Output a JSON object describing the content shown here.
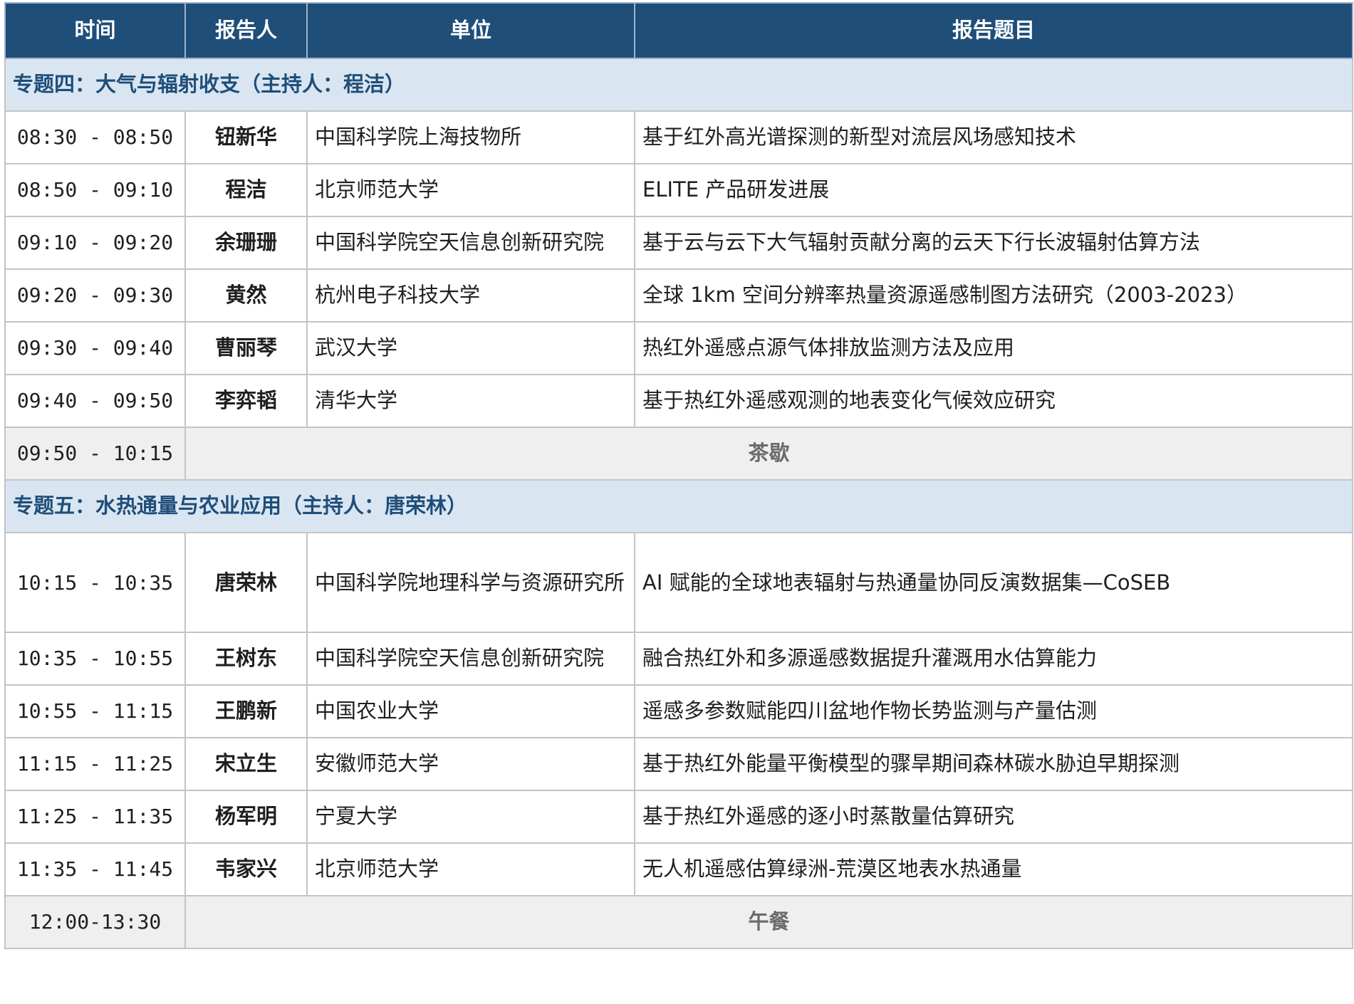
{
  "header": {
    "time": "时间",
    "speaker": "报告人",
    "org": "单位",
    "topic": "报告题目"
  },
  "sections": [
    {
      "title": "专题四：大气与辐射收支（主持人：程洁）",
      "rows": [
        {
          "time": "08:30 - 08:50",
          "speaker": "钮新华",
          "org": "中国科学院上海技物所",
          "topic": "基于红外高光谱探测的新型对流层风场感知技术"
        },
        {
          "time": "08:50 - 09:10",
          "speaker": "程洁",
          "org": "北京师范大学",
          "topic": "ELITE 产品研发进展"
        },
        {
          "time": "09:10 - 09:20",
          "speaker": "余珊珊",
          "org": "中国科学院空天信息创新研究院",
          "topic": "基于云与云下大气辐射贡献分离的云天下行长波辐射估算方法"
        },
        {
          "time": "09:20 - 09:30",
          "speaker": "黄然",
          "org": "杭州电子科技大学",
          "topic": "全球 1km 空间分辨率热量资源遥感制图方法研究（2003-2023）"
        },
        {
          "time": "09:30 - 09:40",
          "speaker": "曹丽琴",
          "org": "武汉大学",
          "topic": "热红外遥感点源气体排放监测方法及应用"
        },
        {
          "time": "09:40 - 09:50",
          "speaker": "李弈韬",
          "org": "清华大学",
          "topic": "基于热红外遥感观测的地表变化气候效应研究"
        }
      ],
      "break": {
        "time": "09:50 - 10:15",
        "label": "茶歇"
      }
    },
    {
      "title": "专题五：水热通量与农业应用（主持人：唐荣林）",
      "rows": [
        {
          "time": "10:15 - 10:35",
          "speaker": "唐荣林",
          "org": "中国科学院地理科学与资源研究所",
          "topic": "AI 赋能的全球地表辐射与热通量协同反演数据集—CoSEB"
        },
        {
          "time": "10:35 - 10:55",
          "speaker": "王树东",
          "org": "中国科学院空天信息创新研究院",
          "topic": "融合热红外和多源遥感数据提升灌溉用水估算能力"
        },
        {
          "time": "10:55 - 11:15",
          "speaker": "王鹏新",
          "org": "中国农业大学",
          "topic": "遥感多参数赋能四川盆地作物长势监测与产量估测"
        },
        {
          "time": "11:15 - 11:25",
          "speaker": "宋立生",
          "org": "安徽师范大学",
          "topic": "基于热红外能量平衡模型的骤旱期间森林碳水胁迫早期探测"
        },
        {
          "time": "11:25 - 11:35",
          "speaker": "杨军明",
          "org": "宁夏大学",
          "topic": "基于热红外遥感的逐小时蒸散量估算研究"
        },
        {
          "time": "11:35 - 11:45",
          "speaker": "韦家兴",
          "org": "北京师范大学",
          "topic": "无人机遥感估算绿洲-荒漠区地表水热通量"
        }
      ],
      "break": {
        "time": "12:00-13:30",
        "label": "午餐"
      }
    }
  ]
}
